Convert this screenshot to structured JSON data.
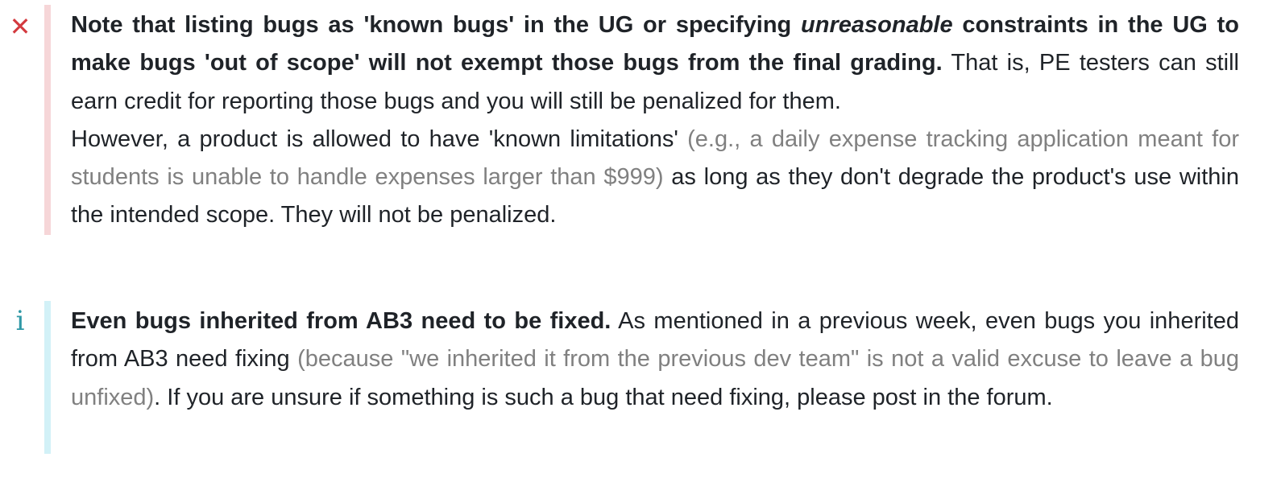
{
  "warning_box": {
    "icon": "times-icon",
    "icon_glyph": "✕",
    "accent_color": "#d33a3f",
    "bar_color": "#f6d6d8",
    "p1_bold_a": "Note that listing bugs as 'known bugs' in the UG or specifying ",
    "p1_bold_italic": "unreasonable",
    "p1_bold_b": " constraints in the UG to make bugs 'out of scope' will not exempt those bugs from the final grading.",
    "p1_rest": " That is, PE testers can still earn credit for reporting those bugs and you will still be penalized for them.",
    "p2_a": "However, a product is allowed to have 'known limitations' ",
    "p2_muted": "(e.g., a daily expense tracking application meant for students is unable to handle expenses larger than $999)",
    "p2_b": " as long as they don't degrade the product's use within the intended scope. They will not be penalized."
  },
  "info_box": {
    "icon": "info-icon",
    "icon_glyph": "i",
    "accent_color": "#2f98a6",
    "bar_color": "#d2f1f7",
    "bold": "Even bugs inherited from AB3 need to be fixed.",
    "text_a": " As mentioned in a previous week, even bugs you inherited from AB3 need fixing ",
    "muted": "(because \"we inherited it from the previous dev team\" is not a valid excuse to leave a bug unfixed)",
    "text_b": ". If you are unsure if something is such a bug that need fixing, please post in the forum."
  }
}
